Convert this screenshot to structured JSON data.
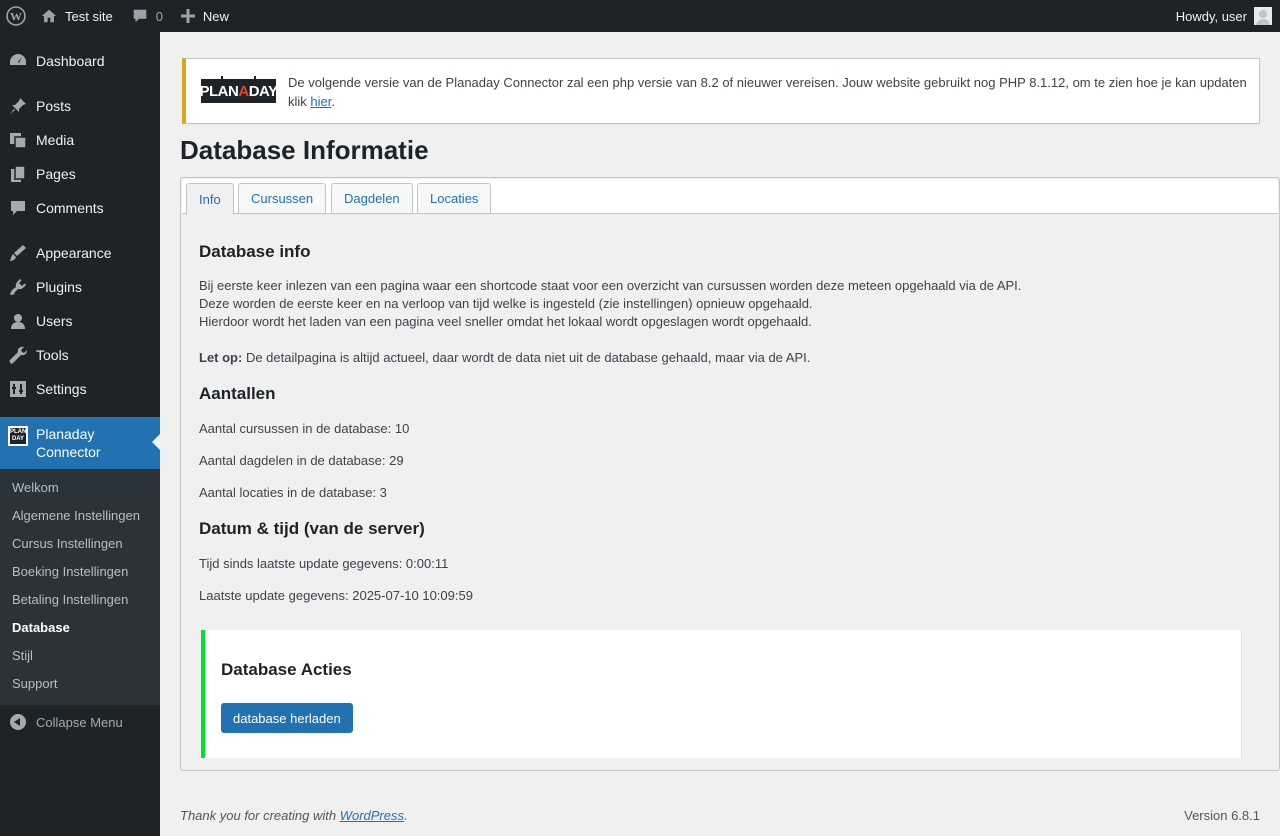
{
  "adminbar": {
    "site_name": "Test site",
    "comments_count": "0",
    "new_label": "New",
    "howdy": "Howdy, user"
  },
  "menu": {
    "items": [
      {
        "label": "Dashboard",
        "icon": "dashboard-icon"
      },
      {
        "label": "Posts",
        "icon": "pin-icon"
      },
      {
        "label": "Media",
        "icon": "media-icon"
      },
      {
        "label": "Pages",
        "icon": "pages-icon"
      },
      {
        "label": "Comments",
        "icon": "comment-icon"
      },
      {
        "label": "Appearance",
        "icon": "brush-icon"
      },
      {
        "label": "Plugins",
        "icon": "plug-icon"
      },
      {
        "label": "Users",
        "icon": "user-icon"
      },
      {
        "label": "Tools",
        "icon": "wrench-icon"
      },
      {
        "label": "Settings",
        "icon": "settings-icon"
      }
    ],
    "current": {
      "line1": "Planaday",
      "line2": "Connector"
    },
    "submenu": [
      "Welkom",
      "Algemene Instellingen",
      "Cursus Instellingen",
      "Boeking Instellingen",
      "Betaling Instellingen",
      "Database",
      "Stijl",
      "Support"
    ],
    "collapse_label": "Collapse Menu"
  },
  "notice": {
    "logo_text_1": "PLAN",
    "logo_text_2": "A",
    "logo_text_3": "DAY",
    "text": "De volgende versie van de Planaday Connector zal een php versie van 8.2 of nieuwer vereisen. Jouw website gebruikt nog PHP 8.1.12, om te zien hoe je kan updaten klik ",
    "link": "hier",
    "after": "."
  },
  "page_title": "Database Informatie",
  "tabs": [
    "Info",
    "Cursussen",
    "Dagdelen",
    "Locaties"
  ],
  "info": {
    "heading": "Database info",
    "line1": "Bij eerste keer inlezen van een pagina waar een shortcode staat voor een overzicht van cursussen worden deze meteen opgehaald via de API.",
    "line2": "Deze worden de eerste keer en na verloop van tijd welke is ingesteld (zie instellingen) opnieuw opgehaald.",
    "line3": "Hierdoor wordt het laden van een pagina veel sneller omdat het lokaal wordt opgeslagen wordt opgehaald.",
    "note_label": "Let op:",
    "note_text": " De detailpagina is altijd actueel, daar wordt de data niet uit de database gehaald, maar via de API."
  },
  "counts": {
    "heading": "Aantallen",
    "cursussen": "Aantal cursussen in de database: 10",
    "dagdelen": "Aantal dagdelen in de database: 29",
    "locaties": "Aantal locaties in de database: 3"
  },
  "datetime": {
    "heading": "Datum & tijd (van de server)",
    "since": "Tijd sinds laatste update gegevens: 0:00:11",
    "last": "Laatste update gegevens: 2025-07-10 10:09:59"
  },
  "actions": {
    "heading": "Database Acties",
    "button": "database herladen",
    "accent": "#00e02a"
  },
  "footer": {
    "thanks": "Thank you for creating with ",
    "link": "WordPress",
    "after": ".",
    "version": "Version 6.8.1"
  },
  "colors": {
    "adminbar_bg": "#1d2327",
    "menu_current_bg": "#2271b1",
    "notice_border": "#dba617",
    "link": "#2271b1"
  }
}
